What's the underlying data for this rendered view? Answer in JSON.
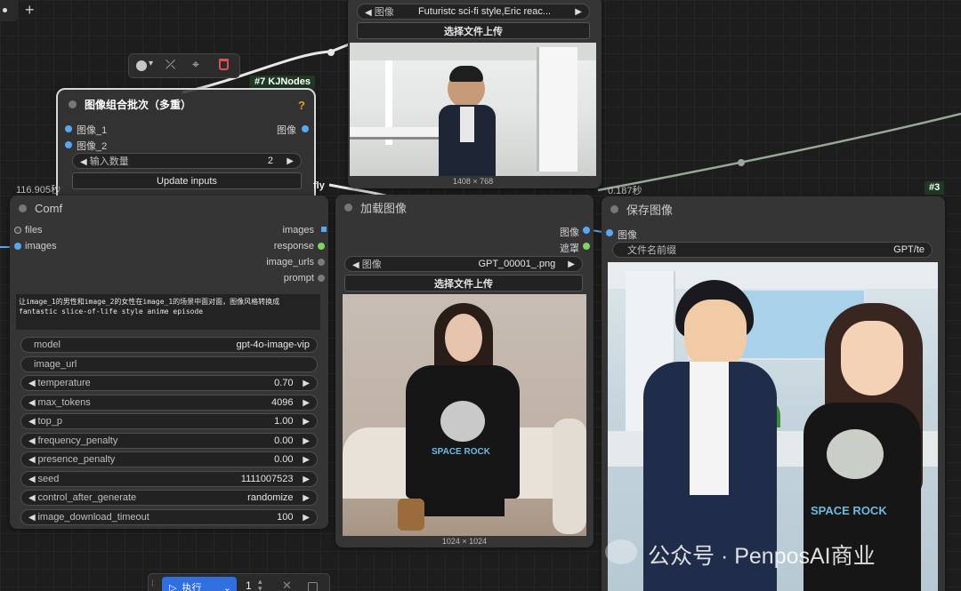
{
  "canvas": {
    "add_tab_icon": "+"
  },
  "float_toolbar": {
    "color_icon": "●",
    "caret": "▾",
    "bypass_icon": "⤫",
    "pin_icon": "⌖",
    "delete_icon": "🗑"
  },
  "top_node": {
    "combo_label": "图像",
    "combo_value": "Futuristc sci-fi style,Eric reac...",
    "upload_label": "选择文件上传",
    "dims": "1408 × 768"
  },
  "batch_node": {
    "badge": "#7 KJNodes",
    "title": "图像组合批次（多重）",
    "help_icon": "?",
    "in1": "图像_1",
    "in2": "图像_2",
    "out": "图像",
    "count_label": "输入数量",
    "count_value": "2",
    "update_label": "Update inputs"
  },
  "gpt_node": {
    "time": "116.905秒",
    "title": "Comf",
    "in_files": "files",
    "in_images": "images",
    "out_images": "images",
    "out_response": "response",
    "out_image_urls": "image_urls",
    "out_prompt": "prompt",
    "prompt_text": "让image_1的男性和image_2的女性在image_1的场景中面对面，图像风格转换成 fantastic slice-of-life style anime episode",
    "widgets": [
      {
        "label": "model",
        "value": "gpt-4o-image-vip",
        "arrows": false
      },
      {
        "label": "image_url",
        "value": "",
        "arrows": false
      },
      {
        "label": "temperature",
        "value": "0.70",
        "arrows": true
      },
      {
        "label": "max_tokens",
        "value": "4096",
        "arrows": true
      },
      {
        "label": "top_p",
        "value": "1.00",
        "arrows": true
      },
      {
        "label": "frequency_penalty",
        "value": "0.00",
        "arrows": true
      },
      {
        "label": "presence_penalty",
        "value": "0.00",
        "arrows": true
      },
      {
        "label": "seed",
        "value": "1111007523",
        "arrows": true
      },
      {
        "label": "control_after_generate",
        "value": "randomize",
        "arrows": true
      },
      {
        "label": "image_download_timeout",
        "value": "100",
        "arrows": true
      }
    ]
  },
  "wire_label": "fly",
  "load_node": {
    "title": "加载图像",
    "out_image": "图像",
    "out_mask": "遮罩",
    "combo_label": "图像",
    "combo_value": "GPT_00001_.png",
    "upload_label": "选择文件上传",
    "dims": "1024 × 1024",
    "shirt_text": "SPACE ROCK"
  },
  "save_node": {
    "time": "0.187秒",
    "badge": "#3",
    "title": "保存图像",
    "in_image": "图像",
    "prefix_label": "文件名前缀",
    "prefix_value": "GPT/te",
    "shirt_text": "SPACE ROCK"
  },
  "watermark": "公众号 · PenposAI商业",
  "run_bar": {
    "run_label": "执行",
    "count": "1"
  },
  "colors": {
    "canvas": "#1d1d1d",
    "node": "#353535",
    "blue_port": "#5aa7f0",
    "green_port": "#7ed55f",
    "badge": "#1f3a22",
    "run_button": "#2f6fe0"
  }
}
